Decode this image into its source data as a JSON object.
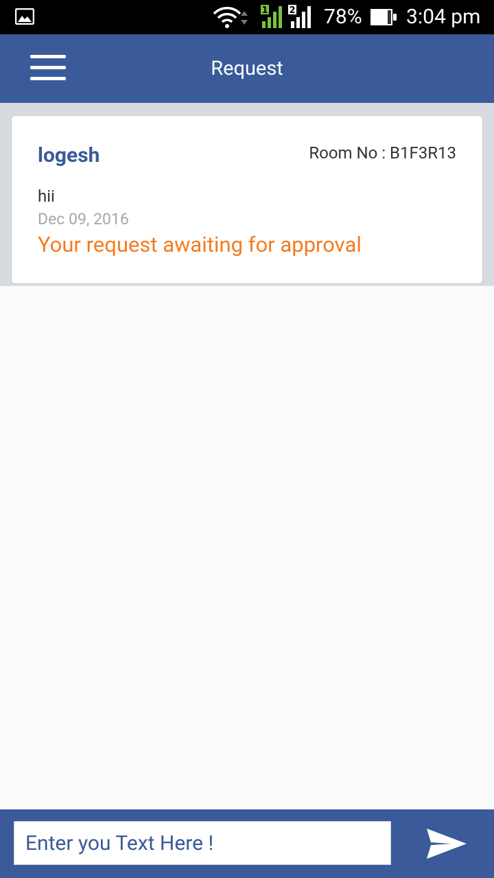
{
  "status_bar": {
    "battery_percent": "78%",
    "time": "3:04 pm",
    "sim1_label": "1",
    "sim2_label": "2"
  },
  "app_bar": {
    "title": "Request"
  },
  "request_card": {
    "name": "logesh",
    "room": "Room No : B1F3R13",
    "message": "hii",
    "date": "Dec 09, 2016",
    "status": "Your request awaiting for approval"
  },
  "composer": {
    "placeholder": "Enter you Text Here !"
  },
  "colors": {
    "primary": "#3a5a99",
    "status_orange": "#f47b20",
    "date_gray": "#a6a6a6"
  }
}
